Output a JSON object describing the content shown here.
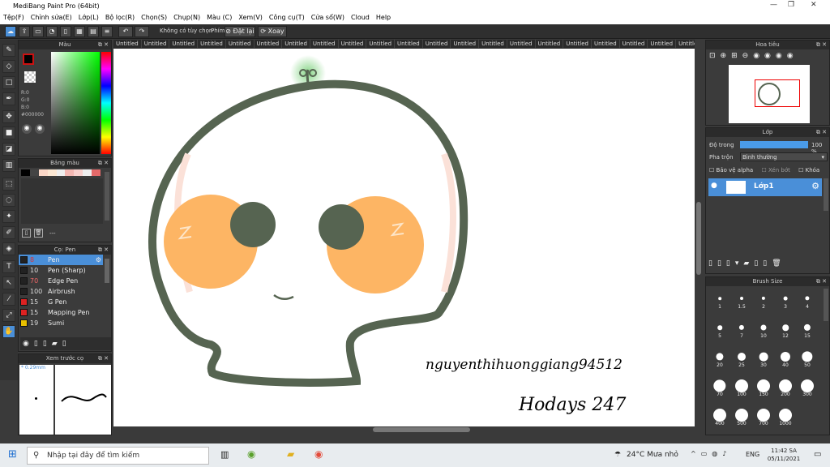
{
  "window": {
    "title": "MediBang Paint Pro (64bit)"
  },
  "menu": [
    "Tệp(F)",
    "Chỉnh sửa(E)",
    "Lớp(L)",
    "Bộ lọc(R)",
    "Chọn(S)",
    "Chụp(N)",
    "Màu (C)",
    "Xem(V)",
    "Công cụ(T)",
    "Cửa sổ(W)",
    "Cloud",
    "Help"
  ],
  "toolbar": {
    "no_selection": "Không có tùy chọn",
    "key_label": "Phím",
    "reset": "Đặt lại",
    "rotate": "Xoay"
  },
  "color_panel": {
    "title": "Màu",
    "r": "R:0",
    "g": "G:0",
    "b": "B:0",
    "hex": "#000000",
    "primary": "#cc1111"
  },
  "palette_panel": {
    "title": "Bảng màu",
    "dash": "---"
  },
  "brush_panel": {
    "title": "Cọ: Pen",
    "items": [
      {
        "size": "8",
        "name": "Pen",
        "color": "#222222"
      },
      {
        "size": "10",
        "name": "Pen (Sharp)",
        "color": "#222222"
      },
      {
        "size": "70",
        "name": "Edge Pen",
        "color": "#222222"
      },
      {
        "size": "100",
        "name": "Airbrush",
        "color": "#222222"
      },
      {
        "size": "15",
        "name": "G Pen",
        "color": "#dd2222"
      },
      {
        "size": "15",
        "name": "Mapping Pen",
        "color": "#dd2222"
      },
      {
        "size": "19",
        "name": "Sumi",
        "color": "#e8c000"
      }
    ]
  },
  "preview_panel": {
    "title": "Xem trước cọ",
    "size": "* 0.29mm"
  },
  "tab_label": "Untitled",
  "canvas": {
    "signature1": "nguyenthihuonggiang94512",
    "signature2": "Hodays 247"
  },
  "nav_panel": {
    "title": "Hoa tiêu"
  },
  "layer_panel": {
    "title": "Lớp",
    "opacity_label": "Độ trong",
    "opacity_value": "100 %",
    "blend_label": "Pha trộn",
    "blend_value": "Bình thường",
    "protect_alpha": "Bảo vệ alpha",
    "clip": "Xén bớt",
    "lock": "Khóa",
    "layer_name": "Lớp1"
  },
  "bsize_panel": {
    "title": "Brush Size",
    "sizes": [
      "1",
      "1.5",
      "2",
      "3",
      "4",
      "5",
      "7",
      "10",
      "12",
      "15",
      "20",
      "25",
      "30",
      "40",
      "50",
      "70",
      "100",
      "150",
      "200",
      "300",
      "400",
      "500",
      "700",
      "1000"
    ]
  },
  "taskbar": {
    "search": "Nhập tại đây để tìm kiếm",
    "weather": "24°C Mưa nhỏ",
    "lang": "ENG",
    "time": "11:42 SA",
    "date": "05/11/2021"
  }
}
